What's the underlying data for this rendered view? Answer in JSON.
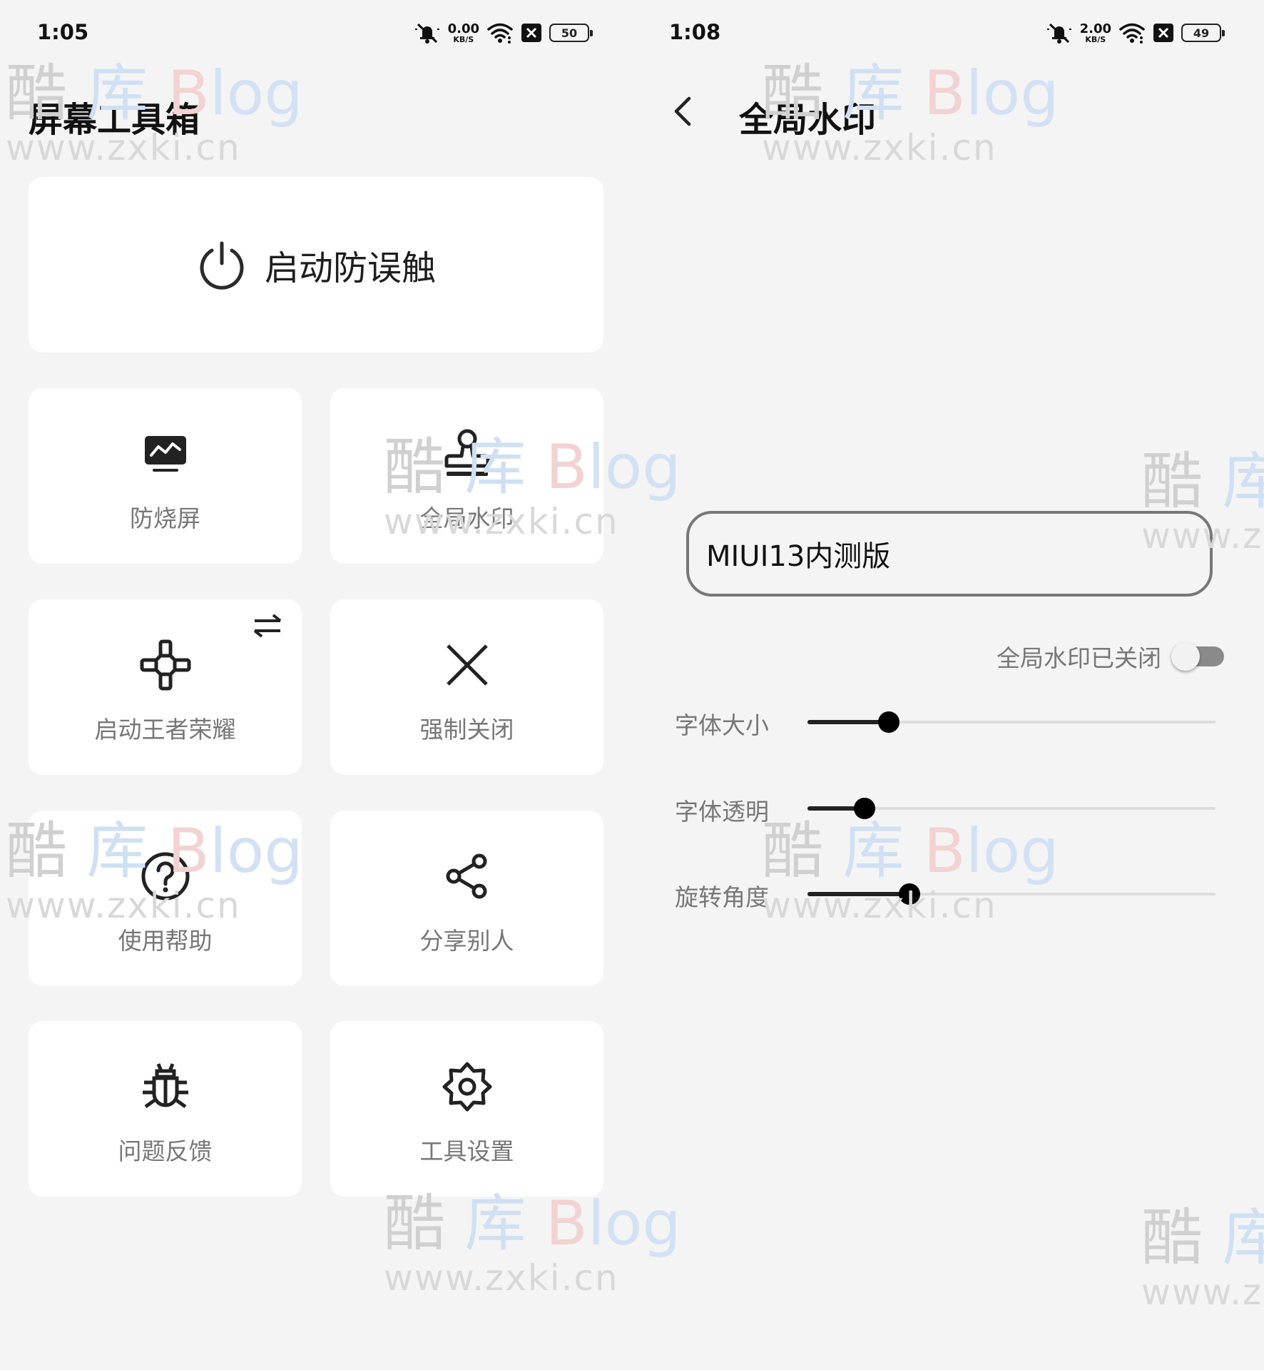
{
  "left": {
    "status": {
      "time": "1:05",
      "net_speed": "0.00",
      "net_unit": "KB/S",
      "battery": "50"
    },
    "title": "屏幕工具箱",
    "hero": {
      "label": "启动防误触",
      "icon": "power-icon"
    },
    "tiles": [
      {
        "label": "防烧屏",
        "icon": "monitor-chart-icon"
      },
      {
        "label": "全局水印",
        "icon": "stamp-icon"
      },
      {
        "label": "启动王者荣耀",
        "icon": "gamepad-icon",
        "badge_icon": "swap-arrows-icon"
      },
      {
        "label": "强制关闭",
        "icon": "close-x-icon"
      },
      {
        "label": "使用帮助",
        "icon": "help-circle-icon"
      },
      {
        "label": "分享别人",
        "icon": "share-icon"
      },
      {
        "label": "问题反馈",
        "icon": "bug-icon"
      },
      {
        "label": "工具设置",
        "icon": "gear-icon"
      }
    ]
  },
  "right": {
    "status": {
      "time": "1:08",
      "net_speed": "2.00",
      "net_unit": "KB/S",
      "battery": "49"
    },
    "title": "全局水印",
    "watermark_text": "MIUI13内测版",
    "toggle": {
      "label": "全局水印已关闭",
      "on": false
    },
    "sliders": [
      {
        "label": "字体大小",
        "value": 0.2
      },
      {
        "label": "字体透明",
        "value": 0.14
      },
      {
        "label": "旋转角度",
        "value": 0.25
      }
    ]
  },
  "watermark": {
    "brand_k": "酷",
    "brand_c": "库",
    "brand_b": "B",
    "brand_log": "log",
    "url": "www.zxki.cn"
  },
  "colors": {
    "background": "#f4f4f4",
    "card": "#ffffff",
    "text_primary": "#111111",
    "text_secondary": "#777777"
  }
}
